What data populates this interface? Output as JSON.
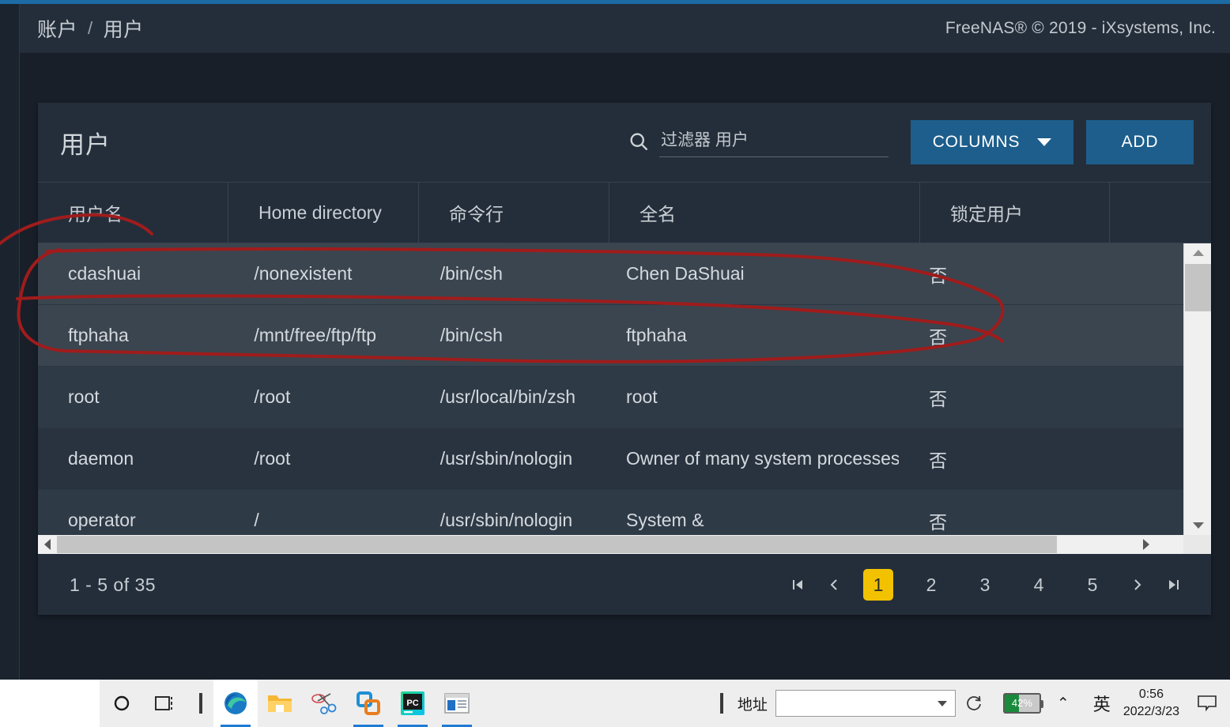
{
  "theme": {
    "accent_blue": "#1d6ba4",
    "button_blue": "#1d5e8c",
    "page_bg": "#181f29",
    "card_bg": "#242e3b",
    "row_bg": "#293340",
    "row_alt_bg": "#2f3a47",
    "row_highlight_bg": "#3b454f",
    "annotation_red": "#a01c1c",
    "active_page_yellow": "#f2c200"
  },
  "header": {
    "breadcrumb": {
      "parent": "账户",
      "separator": "/",
      "current": "用户"
    },
    "copyright": "FreeNAS® © 2019 - iXsystems, Inc."
  },
  "card": {
    "title": "用户",
    "search": {
      "placeholder": "过滤器 用户",
      "value": "",
      "icon": "search-icon"
    },
    "buttons": {
      "columns": {
        "label": "COLUMNS",
        "icon": "chevron-down-icon"
      },
      "add": {
        "label": "ADD"
      }
    }
  },
  "table": {
    "columns": [
      {
        "key": "username",
        "label": "用户名"
      },
      {
        "key": "home",
        "label": "Home directory"
      },
      {
        "key": "shell",
        "label": "命令行"
      },
      {
        "key": "fullname",
        "label": "全名"
      },
      {
        "key": "locked",
        "label": "锁定用户"
      },
      {
        "key": "actions",
        "label": ""
      }
    ],
    "rows": [
      {
        "username": "cdashuai",
        "home": "/nonexistent",
        "shell": "/bin/csh",
        "fullname": "Chen DaShuai",
        "locked": "否",
        "highlighted": true
      },
      {
        "username": "ftphaha",
        "home": "/mnt/free/ftp/ftp",
        "shell": "/bin/csh",
        "fullname": "ftphaha",
        "locked": "否",
        "highlighted": true
      },
      {
        "username": "root",
        "home": "/root",
        "shell": "/usr/local/bin/zsh",
        "fullname": "root",
        "locked": "否",
        "highlighted": false
      },
      {
        "username": "daemon",
        "home": "/root",
        "shell": "/usr/sbin/nologin",
        "fullname": "Owner of many system processes",
        "locked": "否",
        "highlighted": false
      },
      {
        "username": "operator",
        "home": "/",
        "shell": "/usr/sbin/nologin",
        "fullname": "System &",
        "locked": "否",
        "highlighted": false
      }
    ]
  },
  "paginator": {
    "range_label": "1 - 5 of 35",
    "first_label": "|◀",
    "prev_label": "‹",
    "pages": [
      "1",
      "2",
      "3",
      "4",
      "5"
    ],
    "active_page": "1",
    "next_label": "›",
    "last_label": "▶|"
  },
  "taskbar": {
    "icons": [
      {
        "name": "cortana-search-icon",
        "label": ""
      },
      {
        "name": "task-view-icon",
        "label": ""
      },
      {
        "name": "edge-browser-icon",
        "label": ""
      },
      {
        "name": "file-explorer-icon",
        "label": ""
      },
      {
        "name": "snipping-tool-icon",
        "label": ""
      },
      {
        "name": "vmware-workstation-icon",
        "label": ""
      },
      {
        "name": "pycharm-icon",
        "label": "PC"
      },
      {
        "name": "windows-app-icon",
        "label": ""
      }
    ],
    "address_label": "地址",
    "address_value": "",
    "battery_percent": "42%",
    "ime_label": "英",
    "clock_time": "0:56",
    "clock_date": "2022/3/23"
  }
}
